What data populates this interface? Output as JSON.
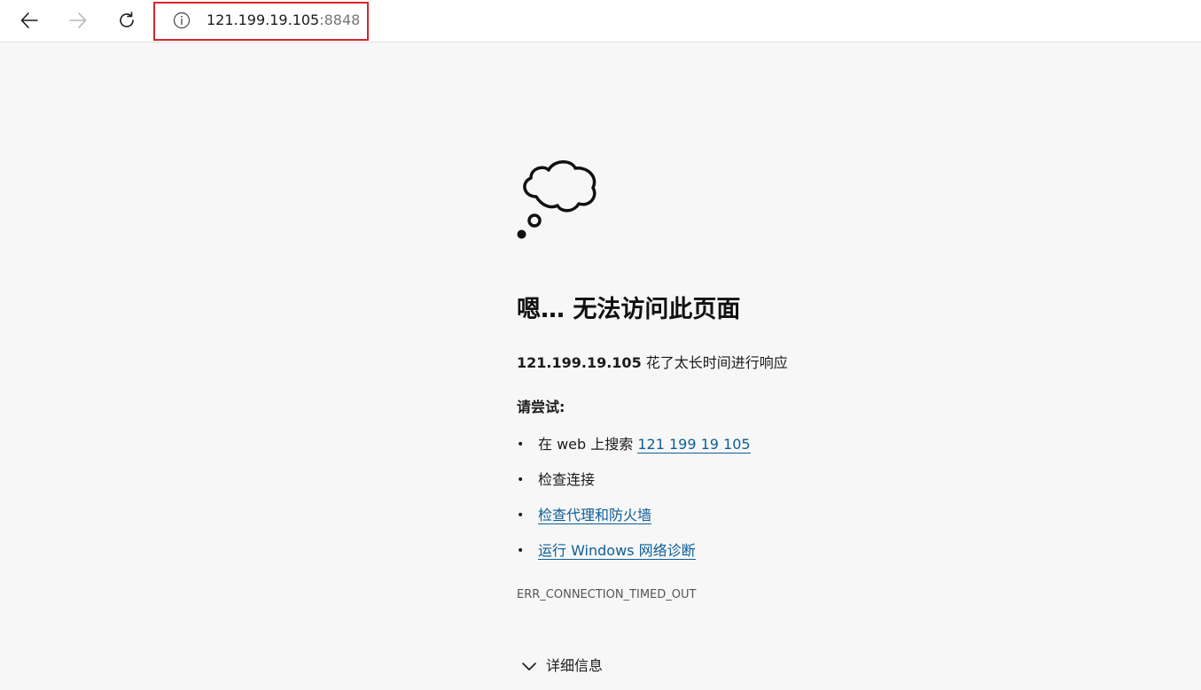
{
  "toolbar": {
    "back_icon": "back-arrow-icon",
    "forward_icon": "forward-arrow-icon",
    "reload_icon": "reload-icon",
    "site_info_icon": "info-icon"
  },
  "address": {
    "host": "121.199.19.105",
    "port": ":8848"
  },
  "error": {
    "title": "嗯… 无法访问此页面",
    "desc_host": "121.199.19.105",
    "desc_rest": " 花了太长时间进行响应",
    "try_heading": "请尝试:",
    "suggestions": [
      {
        "prefix": "在 web 上搜索 ",
        "link": "121 199 19 105"
      },
      {
        "text": "检查连接"
      },
      {
        "link": "检查代理和防火墙"
      },
      {
        "link": "运行 Windows 网络诊断"
      }
    ],
    "code": "ERR_CONNECTION_TIMED_OUT",
    "details_label": "详细信息"
  },
  "colors": {
    "link": "#0e5e96",
    "highlight_box": "#d9262c",
    "background": "#f7f7f7"
  }
}
